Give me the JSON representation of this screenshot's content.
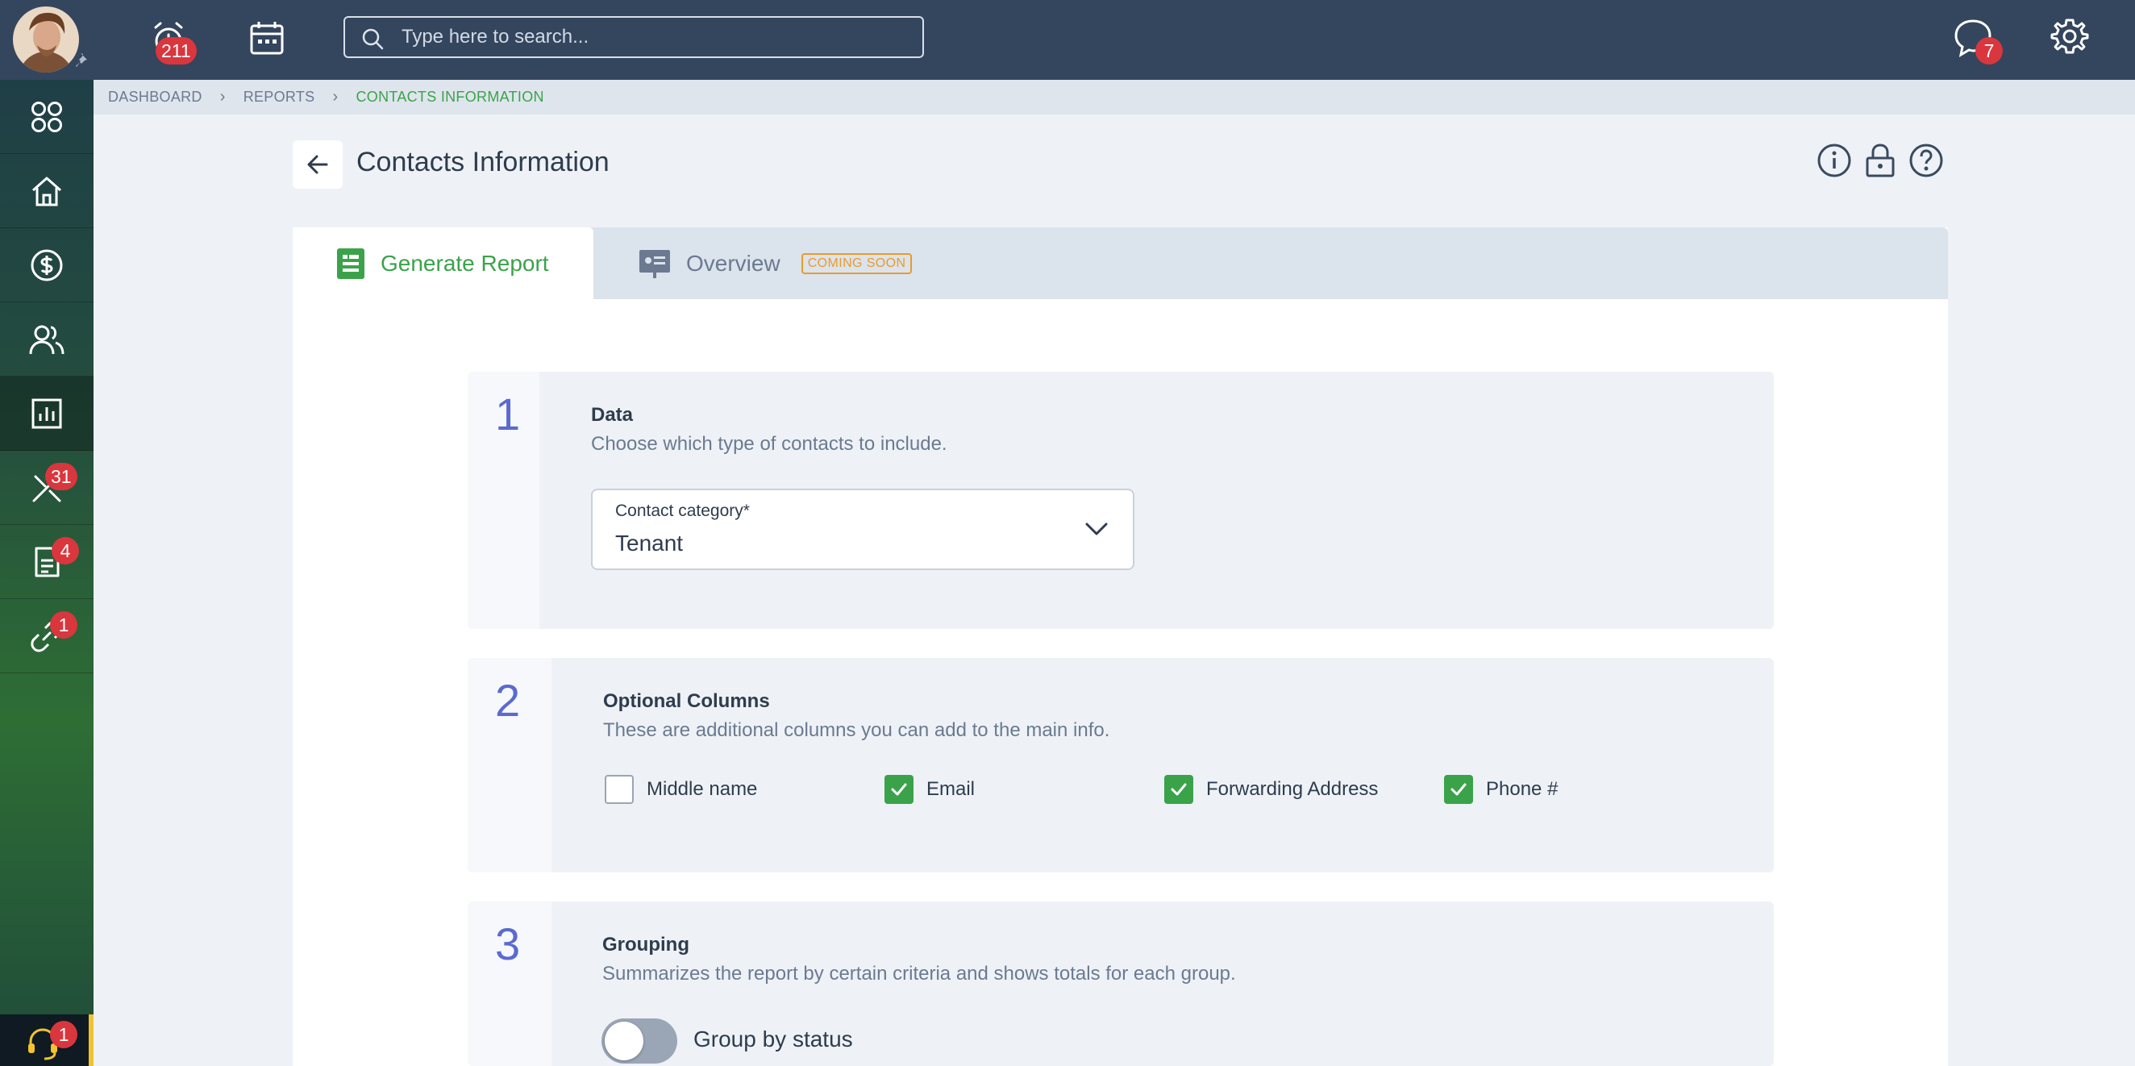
{
  "header": {
    "alarm_badge": "211",
    "messages_badge": "7",
    "search_placeholder": "Type here to search..."
  },
  "sidebar": {
    "items": [
      {
        "name": "apps",
        "badge": ""
      },
      {
        "name": "home",
        "badge": ""
      },
      {
        "name": "accounting",
        "badge": ""
      },
      {
        "name": "people",
        "badge": ""
      },
      {
        "name": "reports",
        "badge": ""
      },
      {
        "name": "maintenance",
        "badge": "31"
      },
      {
        "name": "leasing",
        "badge": "4"
      },
      {
        "name": "communication",
        "badge": "1"
      }
    ],
    "support_badge": "1"
  },
  "breadcrumb": {
    "items": [
      "DASHBOARD",
      "REPORTS",
      "CONTACTS INFORMATION"
    ]
  },
  "page": {
    "title": "Contacts Information"
  },
  "tabs": {
    "generate": "Generate Report",
    "overview": "Overview",
    "coming_soon": "COMING SOON"
  },
  "sections": {
    "data": {
      "number": "1",
      "title": "Data",
      "description": "Choose which type of contacts to include.",
      "select_label": "Contact category*",
      "select_value": "Tenant"
    },
    "columns": {
      "number": "2",
      "title": "Optional Columns",
      "description": "These are additional columns you can add to the main info.",
      "options": [
        {
          "label": "Middle name",
          "checked": false
        },
        {
          "label": "Email",
          "checked": true
        },
        {
          "label": "Forwarding Address",
          "checked": true
        },
        {
          "label": "Phone #",
          "checked": true
        }
      ]
    },
    "grouping": {
      "number": "3",
      "title": "Grouping",
      "description": "Summarizes the report by certain criteria and shows totals for each group.",
      "toggle_label": "Group by status",
      "toggle_on": false
    }
  },
  "colors": {
    "topbar": "#34455e",
    "accent_green": "#3aa34a",
    "badge_red": "#d9363e",
    "section_number": "#5b6ad0",
    "coming_soon": "#e89b2b"
  }
}
